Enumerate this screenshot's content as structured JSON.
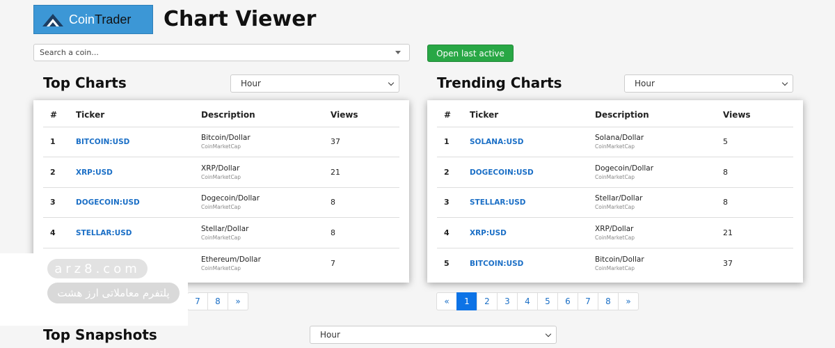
{
  "header": {
    "logo_text_a": "Coin",
    "logo_text_b": "Trader",
    "title": "Chart Viewer"
  },
  "search": {
    "placeholder": "Search a coin..."
  },
  "open_last_active_label": "Open last active",
  "top_charts": {
    "title": "Top Charts",
    "period": "Hour",
    "columns": [
      "#",
      "Ticker",
      "Description",
      "Views"
    ],
    "rows": [
      {
        "rank": "1",
        "ticker": "BITCOIN:USD",
        "desc": "Bitcoin/Dollar",
        "source": "CoinMarketCap",
        "views": "37"
      },
      {
        "rank": "2",
        "ticker": "XRP:USD",
        "desc": "XRP/Dollar",
        "source": "CoinMarketCap",
        "views": "21"
      },
      {
        "rank": "3",
        "ticker": "DOGECOIN:USD",
        "desc": "Dogecoin/Dollar",
        "source": "CoinMarketCap",
        "views": "8"
      },
      {
        "rank": "4",
        "ticker": "STELLAR:USD",
        "desc": "Stellar/Dollar",
        "source": "CoinMarketCap",
        "views": "8"
      },
      {
        "rank": "",
        "ticker": "",
        "desc": "Ethereum/Dollar",
        "source": "CoinMarketCap",
        "views": "7"
      }
    ],
    "pagination": [
      "7",
      "8",
      "»"
    ]
  },
  "trending_charts": {
    "title": "Trending Charts",
    "period": "Hour",
    "columns": [
      "#",
      "Ticker",
      "Description",
      "Views"
    ],
    "rows": [
      {
        "rank": "1",
        "ticker": "SOLANA:USD",
        "desc": "Solana/Dollar",
        "source": "CoinMarketCap",
        "views": "5"
      },
      {
        "rank": "2",
        "ticker": "DOGECOIN:USD",
        "desc": "Dogecoin/Dollar",
        "source": "CoinMarketCap",
        "views": "8"
      },
      {
        "rank": "3",
        "ticker": "STELLAR:USD",
        "desc": "Stellar/Dollar",
        "source": "CoinMarketCap",
        "views": "8"
      },
      {
        "rank": "4",
        "ticker": "XRP:USD",
        "desc": "XRP/Dollar",
        "source": "CoinMarketCap",
        "views": "21"
      },
      {
        "rank": "5",
        "ticker": "BITCOIN:USD",
        "desc": "Bitcoin/Dollar",
        "source": "CoinMarketCap",
        "views": "37"
      }
    ],
    "pagination": [
      "«",
      "1",
      "2",
      "3",
      "4",
      "5",
      "6",
      "7",
      "8",
      "»"
    ],
    "active_page": "1"
  },
  "top_snapshots": {
    "title": "Top Snapshots",
    "period": "Hour"
  },
  "watermark": {
    "line1": "arz8.com",
    "line2": "پلتفرم معاملاتی ارز هشت"
  },
  "colors": {
    "logo_bg": "#3c97d6",
    "button_green": "#28a745",
    "link_blue": "#1b6fc6",
    "active_page": "#0d73e6"
  }
}
